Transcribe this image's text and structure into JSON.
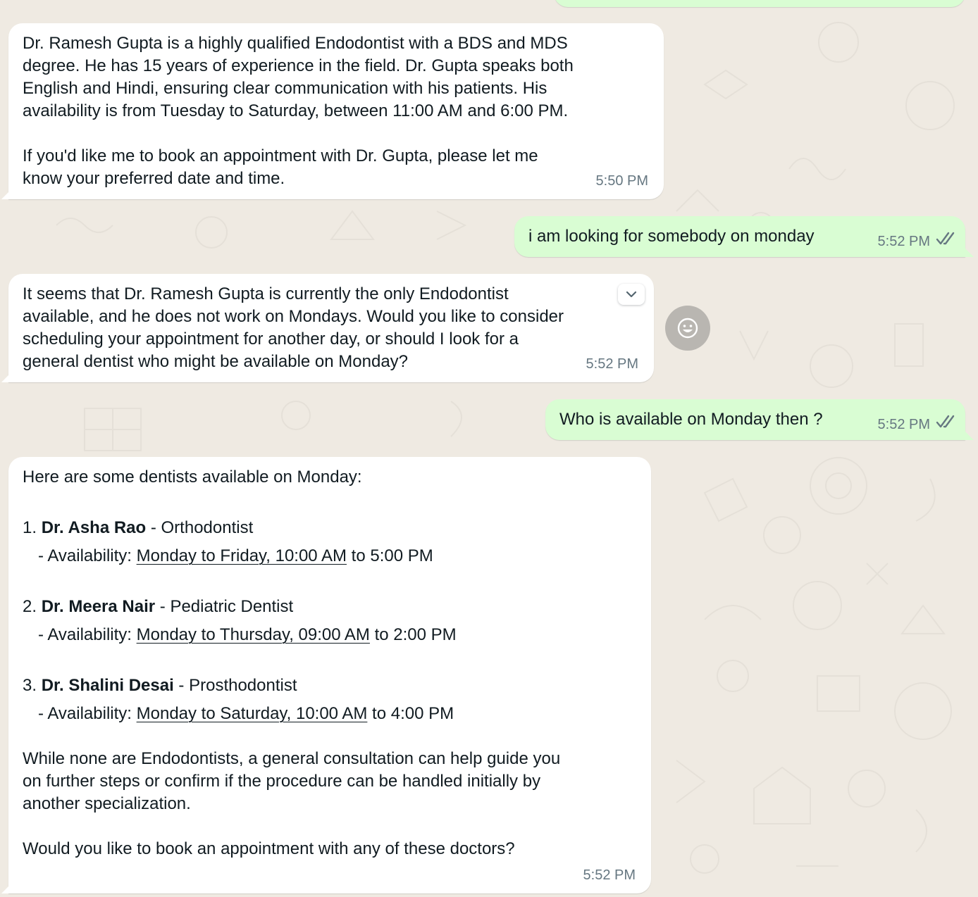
{
  "colors": {
    "chat_background": "#efeae2",
    "incoming_bubble": "#ffffff",
    "outgoing_bubble": "#d9fdd3",
    "read_ticks": "#667781",
    "timestamp": "#667781"
  },
  "messages": {
    "m1": {
      "text": "Dr. Ramesh Gupta is a highly qualified Endodontist with a BDS and MDS\ndegree. He has 15 years of experience in the field. Dr. Gupta speaks both\nEnglish and Hindi, ensuring clear communication with his patients. His\navailability is from Tuesday to Saturday, between 11:00 AM and 6:00 PM.\n\nIf you'd like me to book an appointment with Dr. Gupta, please let me\nknow your preferred date and time.",
      "time": "5:50 PM"
    },
    "m2": {
      "text": "i am looking for somebody on monday",
      "time": "5:52 PM",
      "status_icon": "double-check-icon"
    },
    "m3": {
      "text": "It seems that Dr. Ramesh Gupta is currently the only Endodontist\navailable, and he does not work on Mondays. Would you like to consider\nscheduling your appointment for another day, or should I look for a\ngeneral dentist who might be available on Monday?",
      "time": "5:52 PM",
      "menu_icon": "chevron-down-icon",
      "reaction_icon": "smiley-icon"
    },
    "m4": {
      "text": "Who is available on Monday then ?",
      "time": "5:52 PM",
      "status_icon": "double-check-icon"
    },
    "m5": {
      "intro": "Here are some dentists available on Monday:",
      "doctors": [
        {
          "num": "1.",
          "name": "Dr. Asha Rao",
          "specialty": " - Orthodontist",
          "avail_prefix": "- Availability: ",
          "avail_link": "Monday to Friday, 10:00 AM",
          "avail_suffix": " to 5:00 PM"
        },
        {
          "num": "2.",
          "name": "Dr. Meera Nair",
          "specialty": " - Pediatric Dentist",
          "avail_prefix": "- Availability: ",
          "avail_link": "Monday to Thursday, 09:00 AM",
          "avail_suffix": " to 2:00 PM"
        },
        {
          "num": "3.",
          "name": "Dr. Shalini Desai",
          "specialty": " - Prosthodontist",
          "avail_prefix": "- Availability: ",
          "avail_link": "Monday to Saturday, 10:00 AM",
          "avail_suffix": " to 4:00 PM"
        }
      ],
      "note": "While none are Endodontists, a general consultation can help guide you\non further steps or confirm if the procedure can be handled initially by\nanother specialization.",
      "question": "Would you like to book an appointment with any of these doctors?",
      "time": "5:52 PM"
    }
  }
}
